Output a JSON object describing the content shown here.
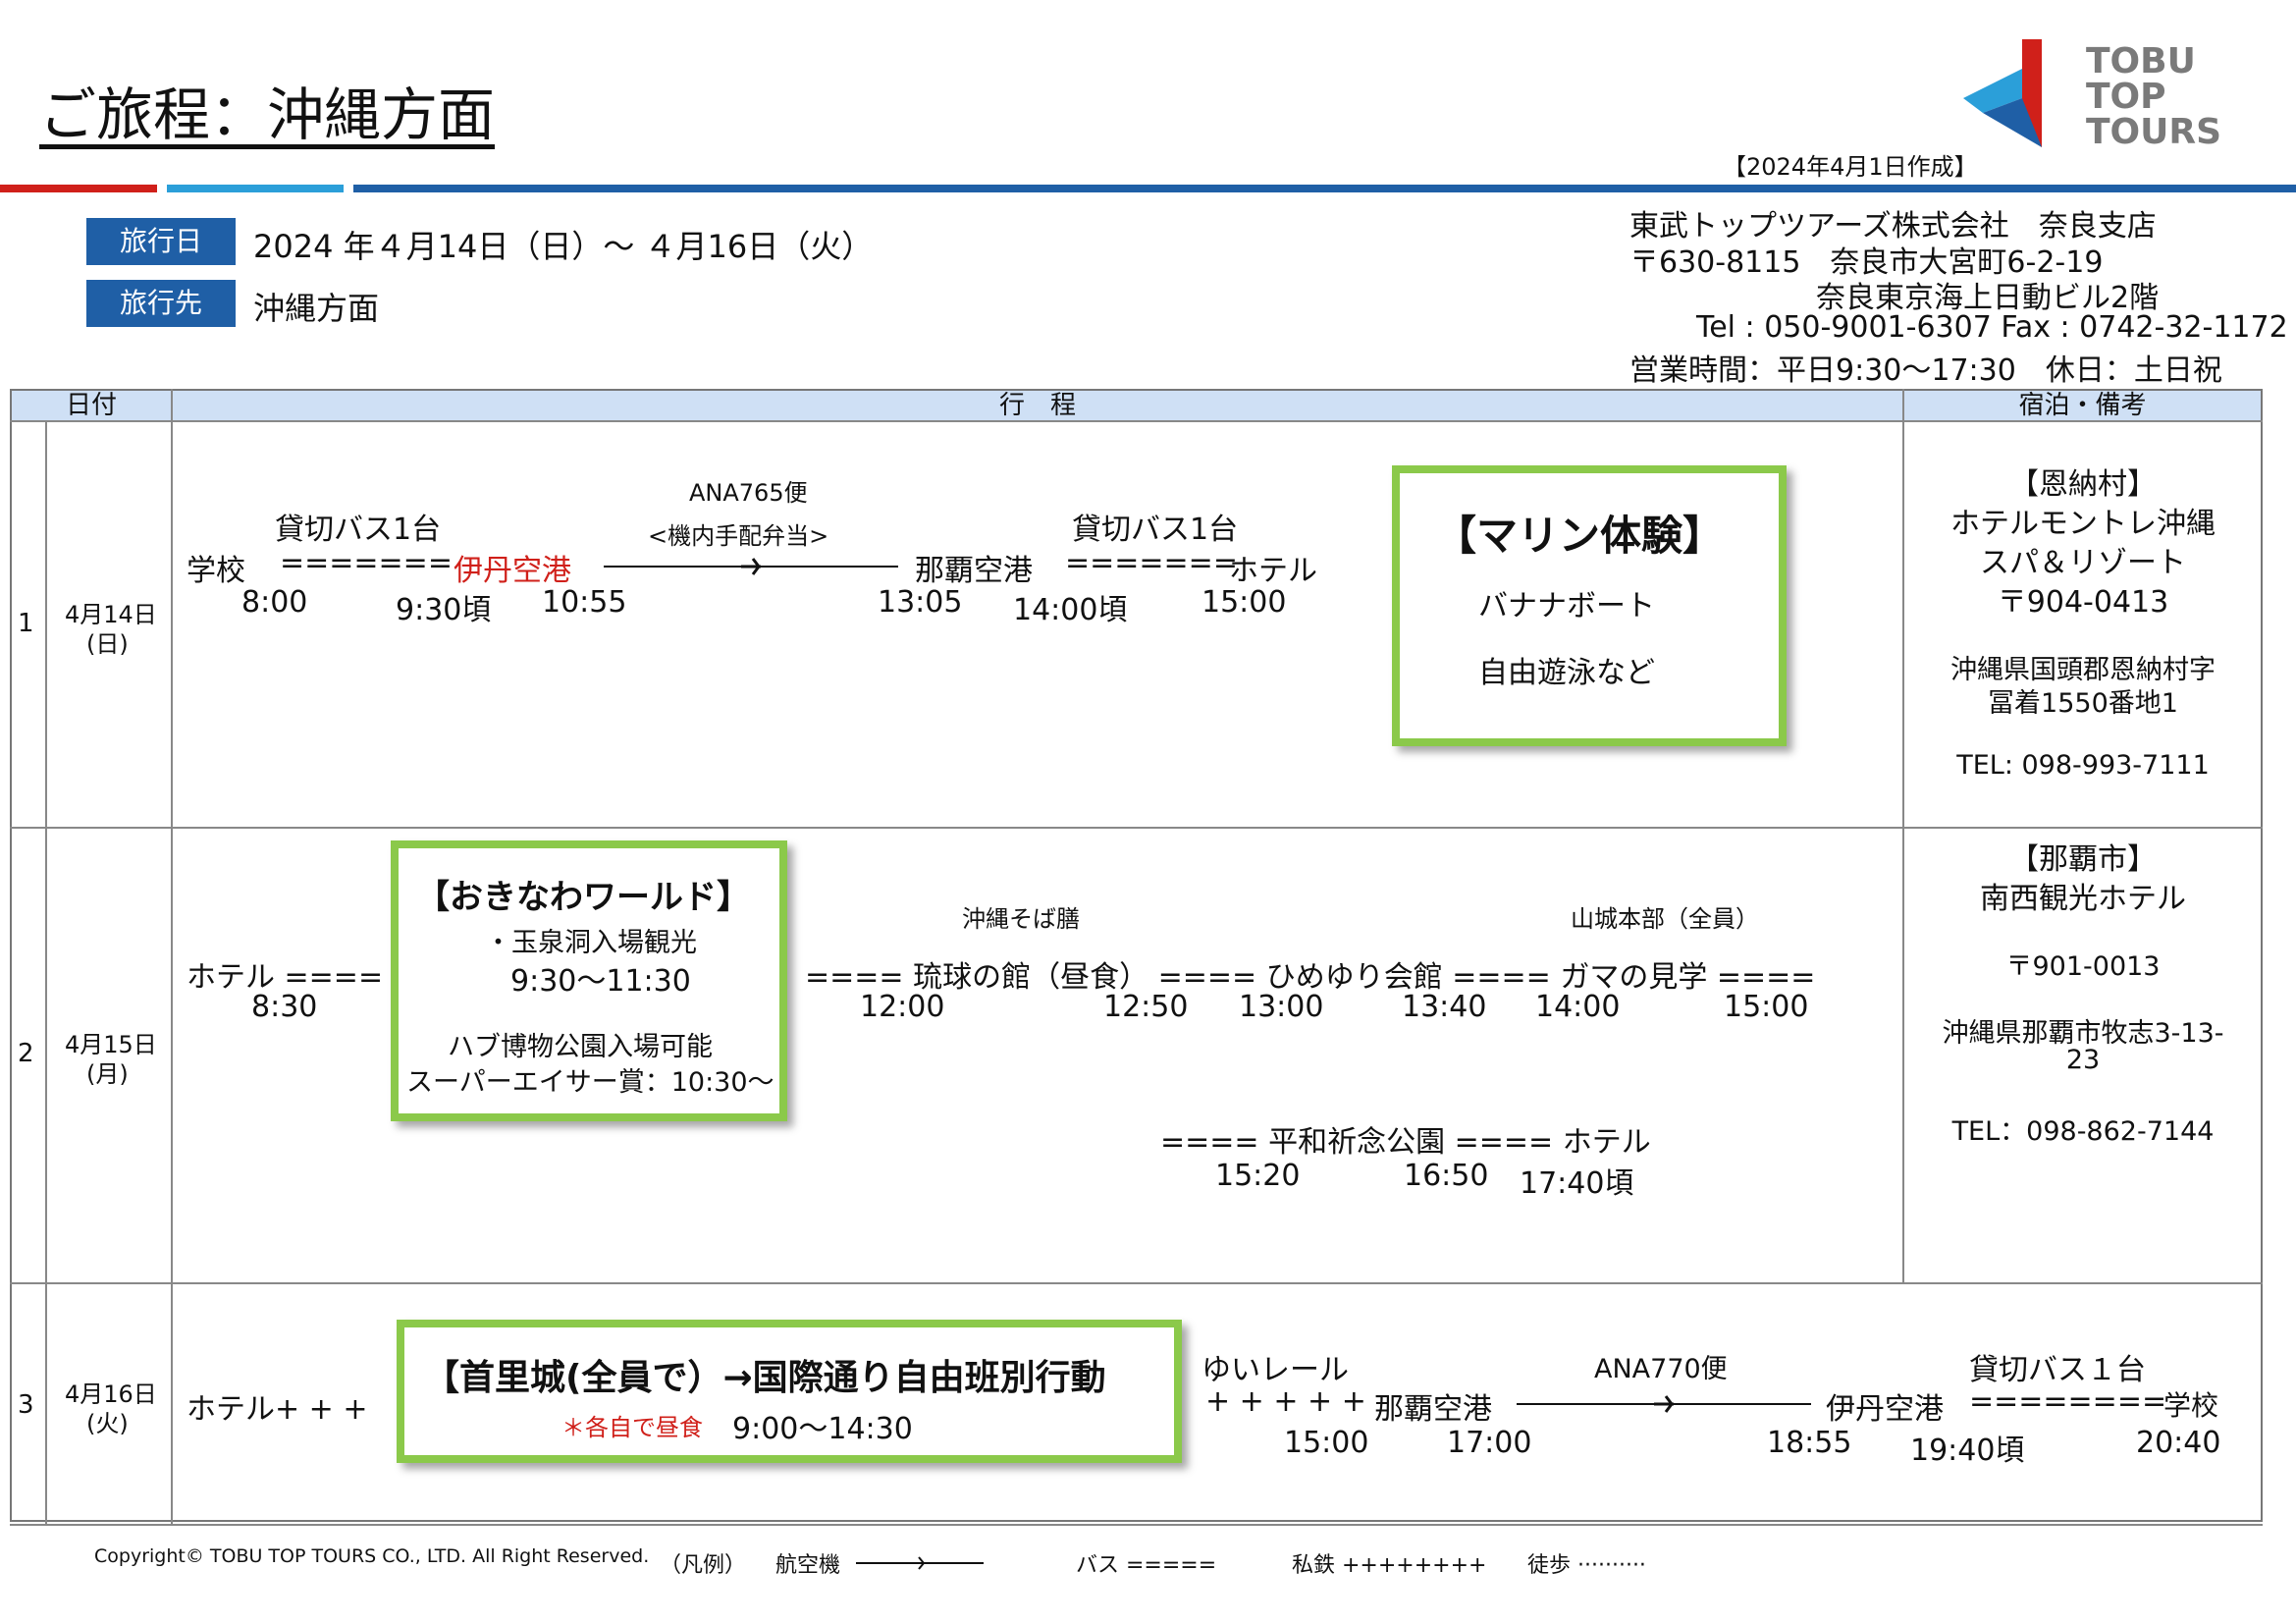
{
  "header": {
    "title": "ご旅程：沖縄方面",
    "created": "【2024年4月1日作成】",
    "logo_lines": [
      "TOBU",
      "TOP",
      "TOURS"
    ]
  },
  "trip": {
    "date_label": "旅行日",
    "date_value": "2024 年４月14日（日）～ ４月16日（火）",
    "dest_label": "旅行先",
    "dest_value": "沖縄方面"
  },
  "company": {
    "name": "東武トップツアーズ株式会社　奈良支店",
    "postal": "〒630-8115　奈良市大宮町6-2-19",
    "building": "奈良東京海上日動ビル2階",
    "tel": "Tel : 050-9001-6307 Fax : 0742-32-1172",
    "hours": "営業時間：平日9:30～17:30　休日：土日祝"
  },
  "table": {
    "headers": [
      "日付",
      "行　程",
      "宿泊・備考"
    ]
  },
  "day1": {
    "num": "1",
    "date": "4月14日",
    "dow": "(日)",
    "bus1": "貸切バス1台",
    "school": "学校",
    "dash1": "=======",
    "itami": "伊丹空港",
    "flight": "ANA765便",
    "bento": "<機内手配弁当>",
    "naha": "那覇空港",
    "bus2": "貸切バス1台",
    "dash2": "=======",
    "hotel": "ホテル",
    "t1": "8:00",
    "t2": "9:30頃",
    "t3": "10:55",
    "t4": "13:05",
    "t5": "14:00頃",
    "t6": "15:00",
    "box_title": "【マリン体験】",
    "box_l1": "バナナボート",
    "box_l2": "自由遊泳など",
    "stay": [
      "【恩納村】",
      "ホテルモントレ沖縄",
      "スパ＆リゾート",
      "〒904-0413",
      "沖縄県国頭郡恩納村字",
      "冨着1550番地1",
      "TEL: 098-993-7111"
    ]
  },
  "day2": {
    "num": "2",
    "date": "4月15日",
    "dow": "(月)",
    "hotel": "ホテル ====",
    "t0": "8:30",
    "box_title": "【おきなわワールド】",
    "box_l1": "・玉泉洞入場観光",
    "box_l2": "9:30～11:30",
    "box_l3": "ハブ博物公園入場可能",
    "box_l4": "スーパーエイサー賞：10:30～",
    "soba": "沖縄そば膳",
    "yamashiro": "山城本部（全員）",
    "route": "==== 琉球の館（昼食） ==== ひめゆり会館 ==== ガマの見学 ====",
    "t1": "12:00",
    "t2": "12:50",
    "t3": "13:00",
    "t4": "13:40",
    "t5": "14:00",
    "t6": "15:00",
    "route2": "====  平和祈念公園 ==== ホテル",
    "t7": "15:20",
    "t8": "16:50",
    "t9": "17:40頃",
    "stay": [
      "【那覇市】",
      "南西観光ホテル",
      "〒901-0013",
      "沖縄県那覇市牧志3-13-",
      "23",
      "TEL：098-862-7144"
    ]
  },
  "day3": {
    "num": "3",
    "date": "4月16日",
    "dow": "(火)",
    "hotel": "ホテル+ + +",
    "box_title": "【首里城(全員で）→国際通り自由班別行動",
    "box_note": "＊各自で昼食",
    "box_time": "9:00～14:30",
    "yui": "ゆいレール",
    "plus": "+ + + + +",
    "naha": "那覇空港",
    "flight": "ANA770便",
    "itami": "伊丹空港",
    "dash": "========",
    "school": "学校",
    "bus": "貸切バス１台",
    "t1": "15:00",
    "t2": "17:00",
    "t3": "18:55",
    "t4": "19:40頃",
    "t5": "20:40"
  },
  "footer": {
    "copyright": "Copyright© TOBU TOP TOURS CO., LTD. All Right Reserved.",
    "legend_label": "（凡例）",
    "plane": "航空機",
    "bus": "バス =====",
    "rail": "私鉄 ++++++++",
    "walk": "徒歩 ··········"
  },
  "colors": {
    "accent_blue": "#1f5fa6",
    "accent_red": "#d0201a",
    "box_green": "#8bc94a",
    "header_bg": "#cfe0f5"
  }
}
